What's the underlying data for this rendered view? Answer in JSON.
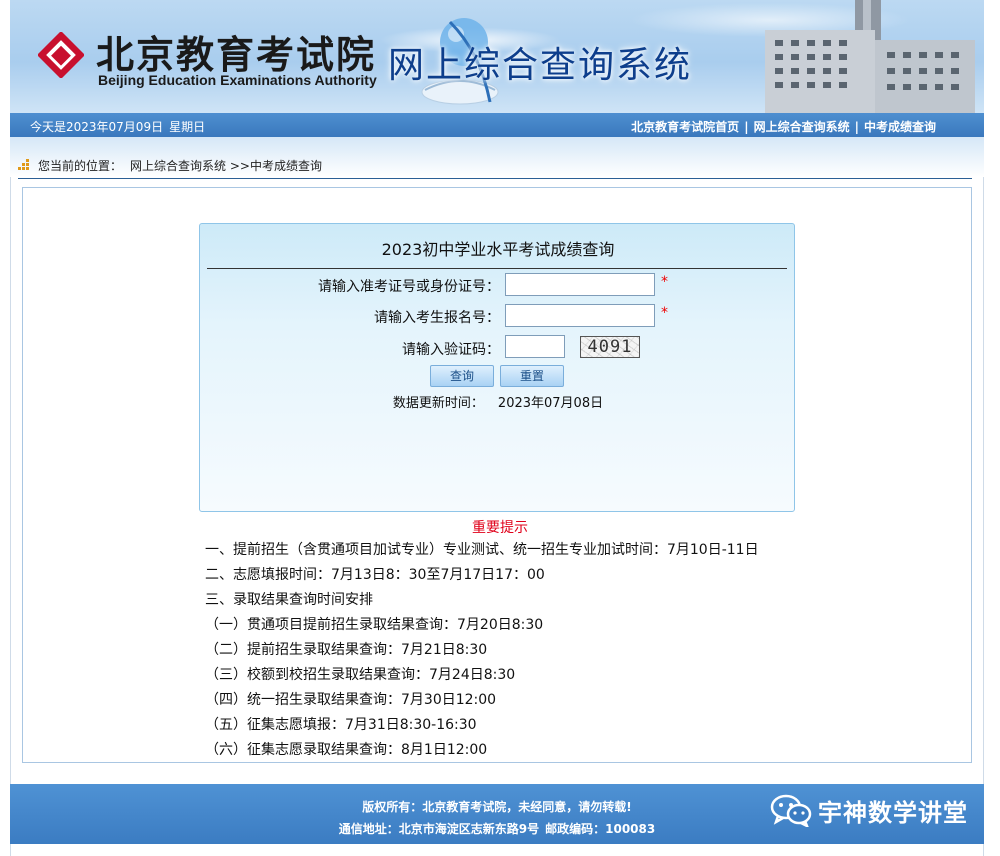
{
  "header": {
    "logo_cn": "北京教育考试院",
    "logo_en": "Beijing Education Examinations Authority",
    "system_title": "网上综合查询系统"
  },
  "navbar": {
    "date": "今天是2023年07月09日",
    "weekday": "星期日",
    "links": [
      "北京教育考试院首页",
      "网上综合查询系统",
      "中考成绩查询"
    ],
    "separator": "|"
  },
  "breadcrumb": {
    "label": "您当前的位置：",
    "path": "网上综合查询系统 >>中考成绩查询"
  },
  "query_form": {
    "title": "2023初中学业水平考试成绩查询",
    "id_label": "请输入准考证号或身份证号：",
    "id_value": "",
    "reg_label": "请输入考生报名号：",
    "reg_value": "",
    "captcha_label": "请输入验证码：",
    "captcha_value": "",
    "captcha_image_text": "4091",
    "required_mark": "*",
    "submit_label": "查询",
    "reset_label": "重置",
    "update_label": "数据更新时间：",
    "update_value": "2023年07月08日"
  },
  "notice": {
    "title": "重要提示",
    "items": [
      "一、提前招生（含贯通项目加试专业）专业测试、统一招生专业加试时间：7月10日-11日",
      "二、志愿填报时间：7月13日8：30至7月17日17：00",
      "三、录取结果查询时间安排",
      "（一）贯通项目提前招生录取结果查询：7月20日8:30",
      "（二）提前招生录取结果查询：7月21日8:30",
      "（三）校额到校招生录取结果查询：7月24日8:30",
      "（四）统一招生录取结果查询：7月30日12:00",
      "（五）征集志愿填报：7月31日8:30-16:30",
      "（六）征集志愿录取结果查询：8月1日12:00"
    ]
  },
  "footer": {
    "copyright": "版权所有：北京教育考试院，未经同意，请勿转载!",
    "address": "通信地址：北京市海淀区志新东路9号",
    "postcode": "邮政编码：100083"
  },
  "watermark": {
    "name": "宇神数学讲堂",
    "icon": "wechat-icon"
  },
  "colors": {
    "nav_blue": "#3a78bd",
    "title_blue": "#0d3e8c",
    "notice_red": "#e0001a",
    "logo_red": "#c8102e"
  }
}
